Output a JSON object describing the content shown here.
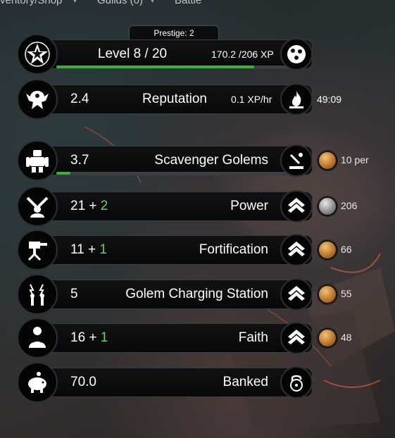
{
  "nav": {
    "items": [
      "ventory/Shop",
      "Guilds (0)",
      "Battle"
    ]
  },
  "prestige": {
    "label": "Prestige: 2"
  },
  "level": {
    "label": "Level 8 / 20",
    "xp": "170.2 /206 XP",
    "progress": 0.826
  },
  "reputation": {
    "value": "2.4",
    "label": "Reputation",
    "rate": "0.1 XP/hr",
    "timer": "49:09"
  },
  "stats": [
    {
      "key": "scavenger",
      "value": "3.7",
      "bonus": "",
      "label": "Scavenger Golems",
      "coin_text": "10 per",
      "coin": "gold",
      "progress": 0.06
    },
    {
      "key": "power",
      "value": "21",
      "bonus": "2",
      "label": "Power",
      "coin_text": "206",
      "coin": "silver"
    },
    {
      "key": "fortification",
      "value": "11",
      "bonus": "1",
      "label": "Fortification",
      "coin_text": "66",
      "coin": "gold"
    },
    {
      "key": "charging",
      "value": "5",
      "bonus": "",
      "label": "Golem Charging Station",
      "coin_text": "55",
      "coin": "gold"
    },
    {
      "key": "faith",
      "value": "16",
      "bonus": "1",
      "label": "Faith",
      "coin_text": "48",
      "coin": "gold"
    }
  ],
  "banked": {
    "value": "70.0",
    "label": "Banked"
  },
  "colors": {
    "accent_green": "#3fae3f",
    "bonus_green": "#6fcf6f",
    "bar_bg": "#0a0b0c"
  }
}
